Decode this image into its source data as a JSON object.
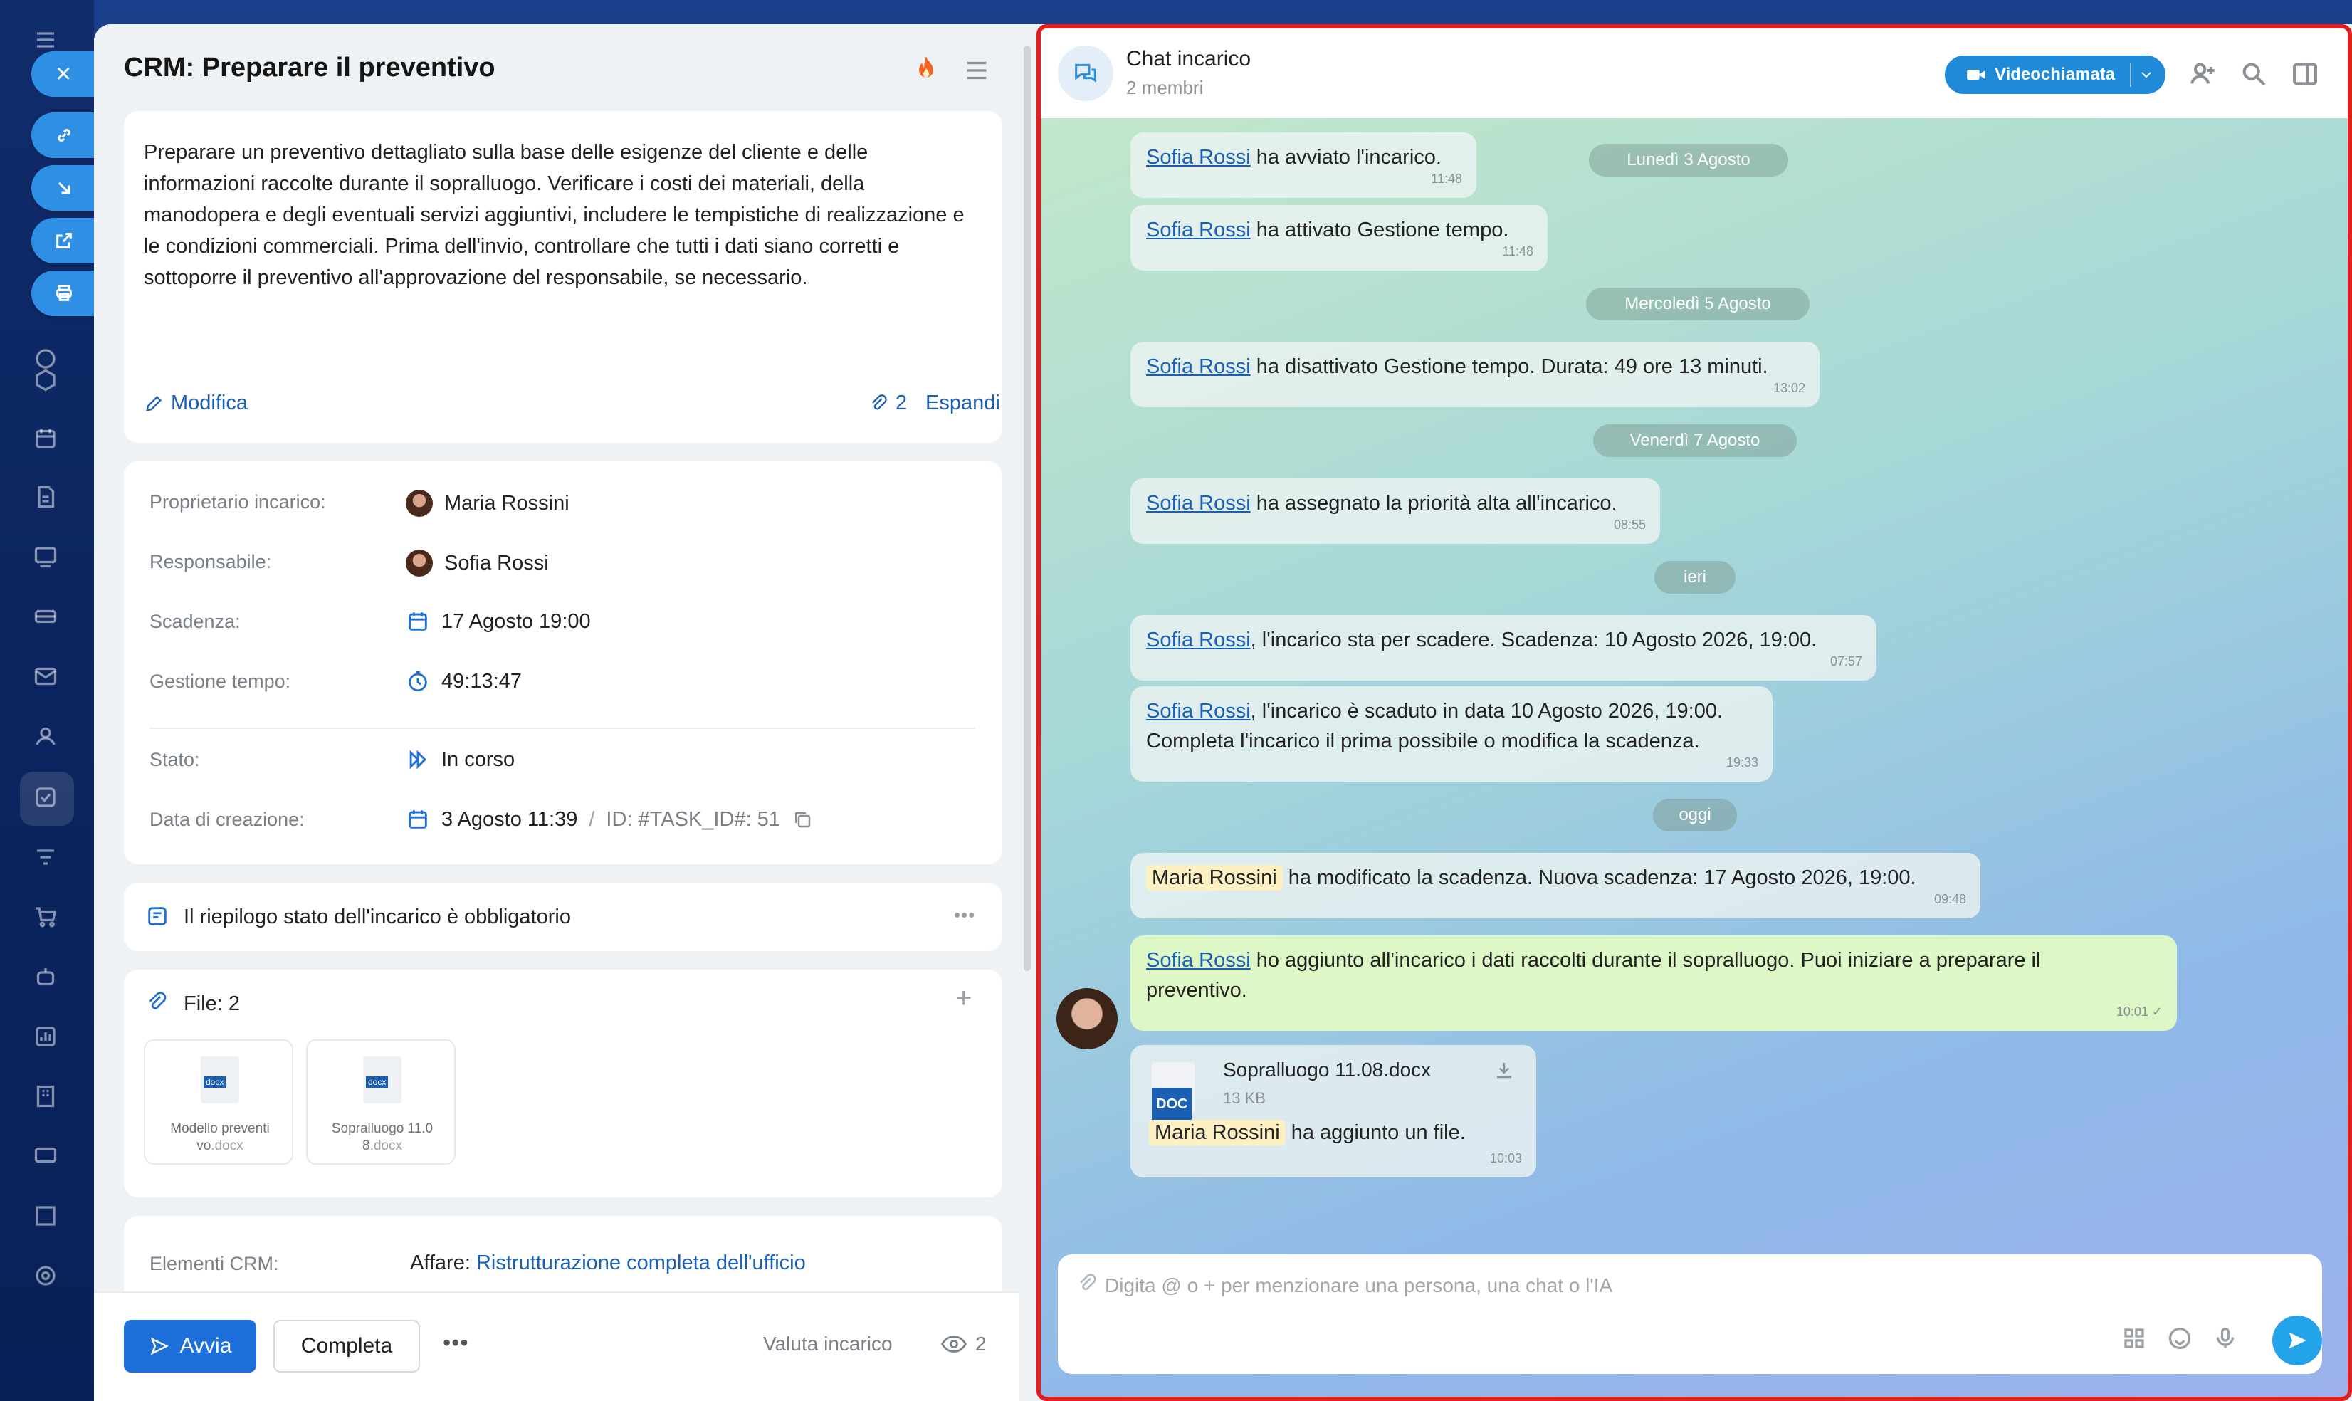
{
  "task": {
    "title": "CRM: Preparare il preventivo",
    "description": "Preparare un preventivo dettagliato sulla base delle esigenze del cliente e delle informazioni raccolte durante il sopralluogo. Verificare i costi dei materiali, della manodopera e degli eventuali servizi aggiuntivi, includere le tempistiche di realizzazione e le condizioni commerciali. Prima dell'invio, controllare che tutti i dati siano corretti e sottoporre il preventivo all'approvazione del responsabile, se necessario.",
    "edit_label": "Modifica",
    "attachments_count": "2",
    "expand_label": "Espandi",
    "fields": {
      "owner_label": "Proprietario incarico:",
      "owner_value": "Maria Rossini",
      "responsible_label": "Responsabile:",
      "responsible_value": "Sofia Rossi",
      "deadline_label": "Scadenza:",
      "deadline_value": "17 Agosto 19:00",
      "time_label": "Gestione tempo:",
      "time_value": "49:13:47",
      "status_label": "Stato:",
      "status_value": "In corso",
      "created_label": "Data di creazione:",
      "created_value": "3 Agosto 11:39",
      "id_separator": "/",
      "id_value": "ID: #TASK_ID#: 51"
    },
    "summary_text": "Il riepilogo stato dell'incarico è obbligatorio",
    "files_title": "File: 2",
    "files": [
      {
        "name": "Modello preventi vo",
        "ext": ".docx",
        "badge": "docx"
      },
      {
        "name": "Sopralluogo 11.0 8",
        "ext": ".docx",
        "badge": "docx"
      }
    ],
    "crm_label": "Elementi CRM:",
    "crm_prefix": "Affare: ",
    "crm_link": "Ristrutturazione completa dell'ufficio",
    "start_label": "Avvia",
    "complete_label": "Completa",
    "more_label": "•••",
    "rate_label": "Valuta incarico",
    "views_count": "2"
  },
  "chat": {
    "title": "Chat incarico",
    "members": "2 membri",
    "video_label": "Videochiamata",
    "dates": {
      "d1": "Lunedì 3 Agosto",
      "d2": "Mercoledì 5 Agosto",
      "d3": "Venerdì 7 Agosto",
      "d4": "ieri",
      "d5": "oggi"
    },
    "messages": {
      "m1": {
        "who": "Sofia Rossi",
        "text": " ha avviato l'incarico.",
        "time": "11:48"
      },
      "m2": {
        "who": "Sofia Rossi",
        "text": " ha attivato Gestione tempo.",
        "time": "11:48"
      },
      "m3": {
        "who": "Sofia Rossi",
        "text": " ha disattivato Gestione tempo. Durata: 49 ore 13 minuti.",
        "time": "13:02"
      },
      "m4": {
        "who": "Sofia Rossi",
        "text": " ha assegnato la priorità alta all'incarico.",
        "time": "08:55"
      },
      "m5": {
        "who": "Sofia Rossi",
        "text": ", l'incarico sta per scadere. Scadenza: 10 Agosto 2026, 19:00.",
        "time": "07:57"
      },
      "m6": {
        "who": "Sofia Rossi",
        "text": ", l'incarico è scaduto in data 10 Agosto 2026, 19:00.",
        "text2": "Completa l'incarico il prima possibile o modifica la scadenza.",
        "time": "19:33"
      },
      "m7": {
        "who": "Maria Rossini",
        "text": " ha modificato la scadenza. Nuova scadenza: 17 Agosto 2026, 19:00.",
        "time": "09:48"
      },
      "m8": {
        "who": "Sofia Rossi",
        "text": " ho aggiunto all'incarico i dati raccolti durante il sopralluogo. Puoi iniziare a preparare il",
        "text2": "preventivo.",
        "time": "10:01"
      },
      "m9": {
        "file_name": "Sopralluogo 11.08.docx",
        "file_size": "13 KB",
        "file_badge": "DOC",
        "who": "Maria Rossini",
        "text": " ha aggiunto un file.",
        "time": "10:03"
      }
    },
    "input_placeholder": "Digita @ o + per menzionare una persona, una chat o l'IA"
  },
  "colors": {
    "accent": "#1e6fd9",
    "link": "#1a5fb4",
    "frame_highlight": "#e02020",
    "send": "#23a3e8"
  }
}
